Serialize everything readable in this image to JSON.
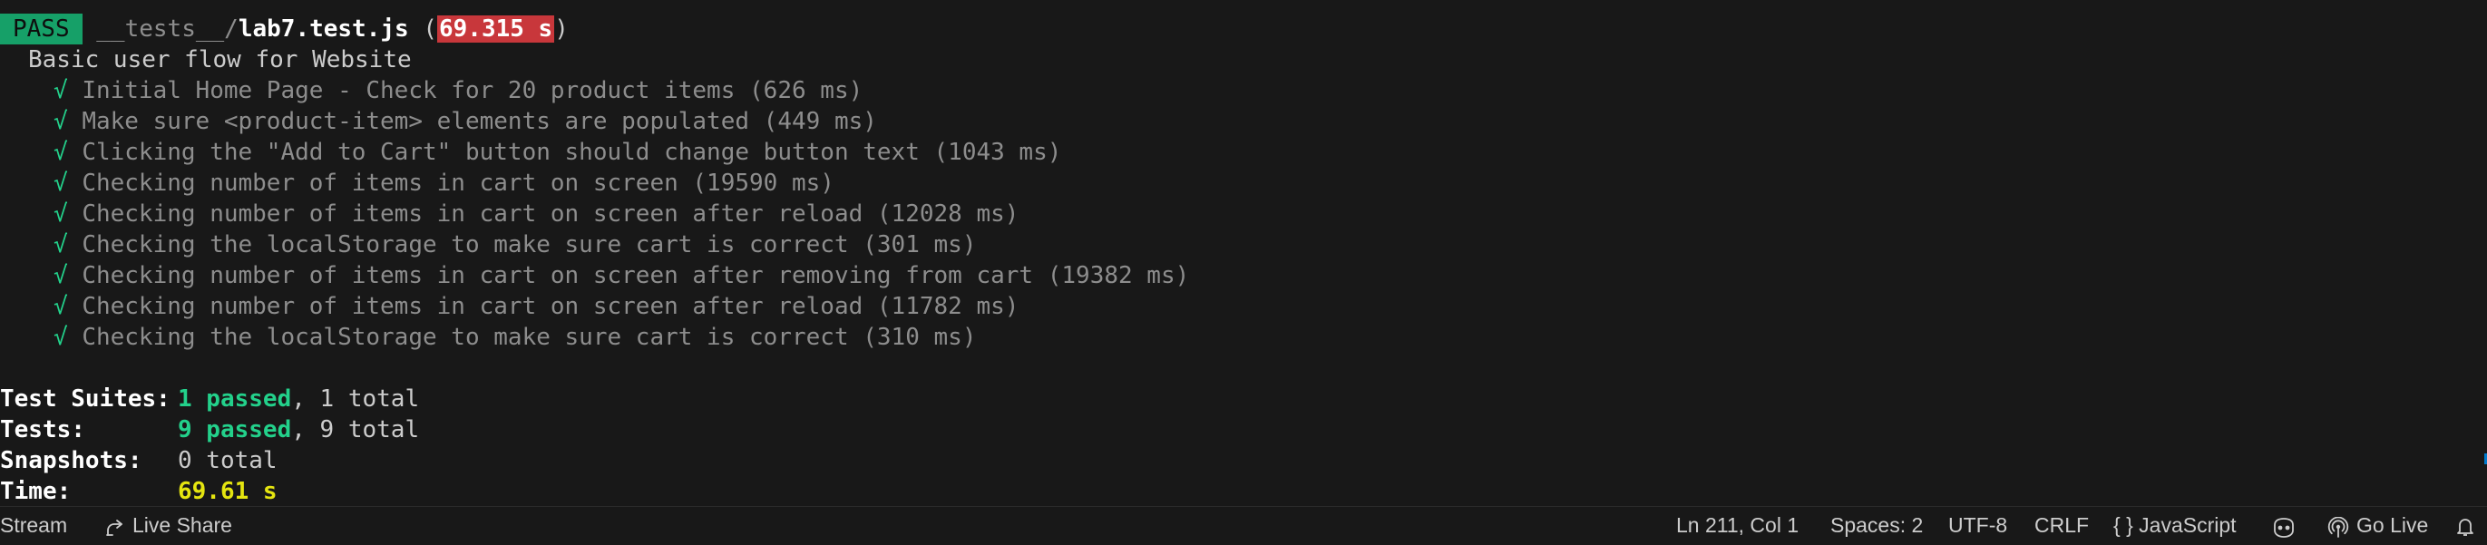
{
  "header": {
    "status": "PASS",
    "path_dir": "__tests__/",
    "file": "lab7.test.js",
    "open_paren": " (",
    "duration": "69.315 s",
    "close_paren": ")"
  },
  "suite": {
    "title": "Basic user flow for Website",
    "check_mark": "√",
    "tests": [
      {
        "name": "Initial Home Page - Check for 20 product items (626 ms)"
      },
      {
        "name": "Make sure <product-item> elements are populated (449 ms)"
      },
      {
        "name": "Clicking the \"Add to Cart\" button should change button text (1043 ms)"
      },
      {
        "name": "Checking number of items in cart on screen (19590 ms)"
      },
      {
        "name": "Checking number of items in cart on screen after reload (12028 ms)"
      },
      {
        "name": "Checking the localStorage to make sure cart is correct (301 ms)"
      },
      {
        "name": "Checking number of items in cart on screen after removing from cart (19382 ms)"
      },
      {
        "name": "Checking number of items in cart on screen after reload (11782 ms)"
      },
      {
        "name": "Checking the localStorage to make sure cart is correct (310 ms)"
      }
    ]
  },
  "summary": {
    "suites_label": "Test Suites:",
    "suites_passed": "1 passed",
    "suites_total": ", 1 total",
    "tests_label": "Tests:",
    "tests_passed": "9 passed",
    "tests_total": ", 9 total",
    "snapshots_label": "Snapshots:",
    "snapshots_value": "0 total",
    "time_label": "Time:",
    "time_value": "69.61 s"
  },
  "statusbar": {
    "stream": "Stream",
    "live_share": "Live Share",
    "cursor": "Ln 211, Col 1",
    "spaces": "Spaces: 2",
    "encoding": "UTF-8",
    "eol": "CRLF",
    "language_braces": "{ }",
    "language": "JavaScript",
    "go_live": "Go Live"
  },
  "colors": {
    "background": "#181818",
    "pass_badge": "#16a068",
    "duration_badge": "#c8373b",
    "check_green": "#23d18b",
    "time_yellow": "#e5e510"
  }
}
